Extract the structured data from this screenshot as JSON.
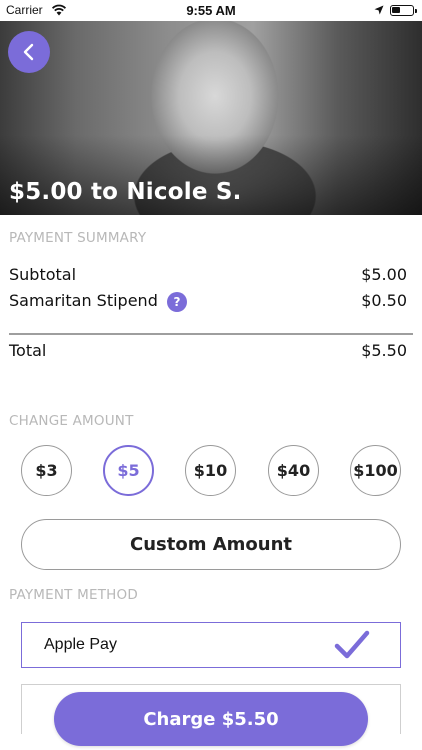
{
  "status_bar": {
    "carrier": "Carrier",
    "time": "9:55 AM"
  },
  "hero": {
    "title": "$5.00 to Nicole S."
  },
  "payment_summary": {
    "label": "PAYMENT SUMMARY",
    "rows": [
      {
        "label": "Subtotal",
        "value": "$5.00"
      },
      {
        "label": "Samaritan Stipend",
        "value": "$0.50",
        "help": "?"
      }
    ],
    "total": {
      "label": "Total",
      "value": "$5.50"
    }
  },
  "change_amount": {
    "label": "CHANGE AMOUNT",
    "options": [
      "$3",
      "$5",
      "$10",
      "$40",
      "$100"
    ],
    "selected": "$5",
    "custom_label": "Custom Amount"
  },
  "payment_method": {
    "label": "PAYMENT METHOD",
    "options": [
      {
        "label": "Apple Pay",
        "selected": true
      }
    ]
  },
  "charge": {
    "label": "Charge $5.50"
  },
  "colors": {
    "accent": "#7b6cd9"
  },
  "icons": [
    "wifi-icon",
    "location-arrow-icon",
    "battery-icon",
    "back-chevron-icon",
    "question-icon",
    "checkmark-icon"
  ]
}
